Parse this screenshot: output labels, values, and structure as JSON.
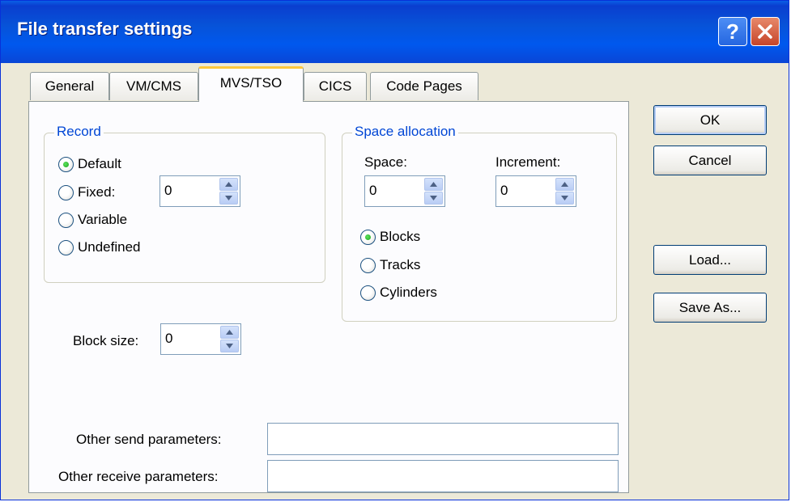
{
  "window": {
    "title": "File transfer settings"
  },
  "titlebar_buttons": {
    "help": "?"
  },
  "tabs": [
    {
      "label": "General"
    },
    {
      "label": "VM/CMS"
    },
    {
      "label": "MVS/TSO"
    },
    {
      "label": "CICS"
    },
    {
      "label": "Code Pages"
    }
  ],
  "active_tab": "MVS/TSO",
  "record": {
    "legend": "Record",
    "options": [
      "Default",
      "Fixed:",
      "Variable",
      "Undefined"
    ],
    "selected": "Default",
    "fixed_value": "0"
  },
  "block_size": {
    "label": "Block size:",
    "value": "0"
  },
  "space_allocation": {
    "legend": "Space allocation",
    "space_label": "Space:",
    "space_value": "0",
    "increment_label": "Increment:",
    "increment_value": "0",
    "units": [
      "Blocks",
      "Tracks",
      "Cylinders"
    ],
    "selected_unit": "Blocks"
  },
  "other": {
    "send_label": "Other send parameters:",
    "send_value": "",
    "receive_label": "Other receive parameters:",
    "receive_value": ""
  },
  "buttons": {
    "ok": "OK",
    "cancel": "Cancel",
    "load": "Load...",
    "save_as": "Save As..."
  },
  "colors": {
    "titlebar": "#0a5fe6",
    "group_legend": "#0046d5",
    "active_tab_highlight": "#ffc83c",
    "radio_dot": "#21a121"
  },
  "icons": {
    "help": "help-icon",
    "close": "close-icon",
    "spin_up": "arrow-up-icon",
    "spin_down": "arrow-down-icon"
  }
}
